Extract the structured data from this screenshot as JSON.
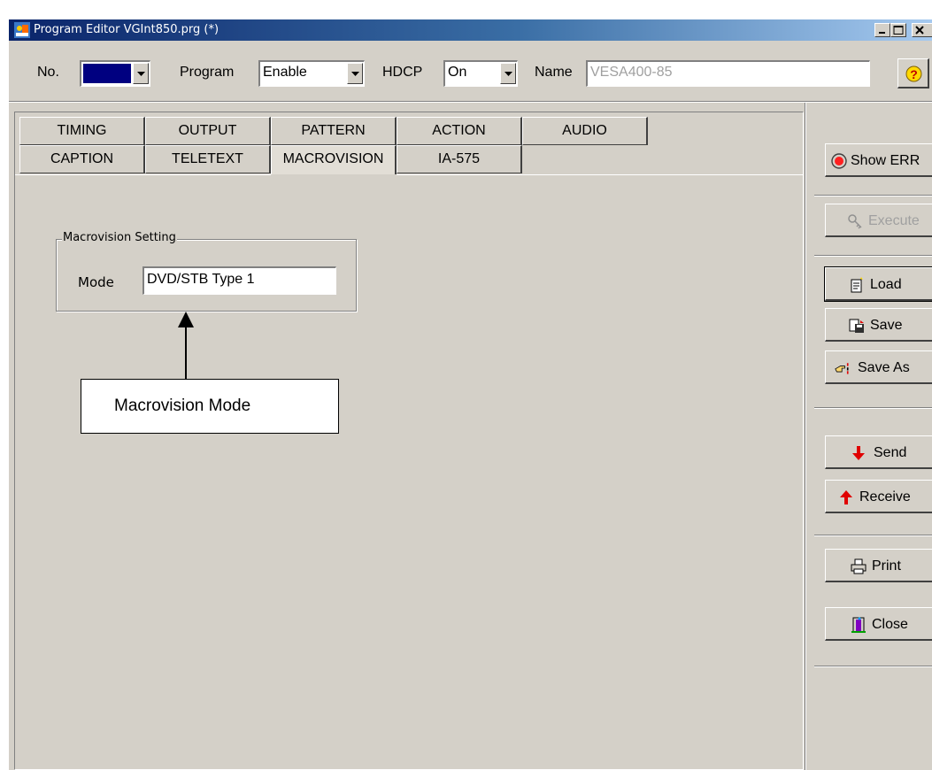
{
  "window": {
    "title": "Program Editor VGInt850.prg (*)",
    "icons": {
      "app": "program-editor-icon",
      "minimize": "minimize-icon",
      "maximize": "maximize-icon",
      "close": "close-icon"
    }
  },
  "toolbar": {
    "no_label": "No.",
    "no_value": "",
    "program_label": "Program",
    "program_value": "Enable",
    "hdcp_label": "HDCP",
    "hdcp_value": "On",
    "name_label": "Name",
    "name_value": "VESA400-85",
    "help_icon": "question-icon"
  },
  "tabs": {
    "row1": [
      "TIMING",
      "OUTPUT",
      "PATTERN",
      "ACTION",
      "AUDIO"
    ],
    "row2": [
      "CAPTION",
      "TELETEXT",
      "MACROVISION",
      "IA-575"
    ],
    "active": "MACROVISION"
  },
  "macrovision": {
    "group_title": "Macrovision Setting",
    "mode_label": "Mode",
    "mode_value": "DVD/STB Type 1"
  },
  "callout": {
    "text": "Macrovision Mode"
  },
  "side_buttons": {
    "show_err": "Show ERR",
    "execute": "Execute",
    "load": "Load",
    "save": "Save",
    "save_as": "Save As",
    "send": "Send",
    "receive": "Receive",
    "print": "Print",
    "close": "Close"
  },
  "colors": {
    "title_start": "#0a246a",
    "title_end": "#a6caf0",
    "face": "#d4d0c8",
    "no_field": "#000080",
    "send_arrow": "#e00000",
    "name_text": "#a0a0a0"
  }
}
